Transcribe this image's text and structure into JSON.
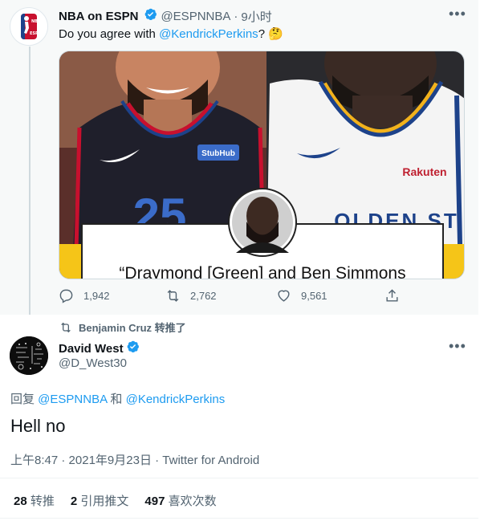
{
  "quoted_tweet": {
    "author_name": "NBA on ESPN",
    "handle": "@ESPNNBA",
    "separator": "·",
    "time": "9小时",
    "text_before": "Do you agree with ",
    "mention": "@KendrickPerkins",
    "text_after": "?",
    "emoji": "🤔",
    "media": {
      "sponsor_patch": "StubHub",
      "jersey_number": "25",
      "sponsor_gsw": "Rakuten",
      "team_text": "OLDEN ST",
      "quote_text": "“Draymond [Green] and Ben Simmons"
    },
    "actions": {
      "replies": "1,942",
      "retweets": "2,762",
      "likes": "9,561"
    }
  },
  "retweet_context": {
    "text": "Benjamin Cruz 转推了"
  },
  "main_tweet": {
    "author_name": "David West",
    "handle": "@D_West30",
    "reply_prefix": "回复 ",
    "reply_mention_1": "@ESPNNBA",
    "reply_and": " 和 ",
    "reply_mention_2": "@KendrickPerkins",
    "text": "Hell no",
    "time": "上午8:47",
    "dot": " · ",
    "date": "2021年9月23日",
    "source": "Twitter for Android",
    "stats": {
      "retweets_count": "28",
      "retweets_label": "转推",
      "quotes_count": "2",
      "quotes_label": "引用推文",
      "likes_count": "497",
      "likes_label": "喜欢次数"
    }
  },
  "colors": {
    "accent": "#1d9bf0",
    "muted": "#536471",
    "background_quoted": "#f7f9f9"
  }
}
